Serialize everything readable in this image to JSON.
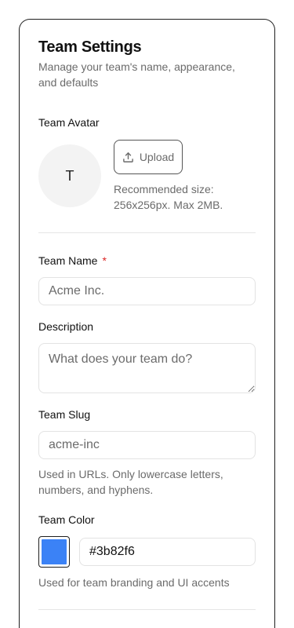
{
  "header": {
    "title": "Team Settings",
    "subtitle": "Manage your team's name, appearance, and defaults"
  },
  "avatar": {
    "label": "Team Avatar",
    "initial": "T",
    "upload_label": "Upload",
    "upload_icon": "upload-icon",
    "hint": "Recommended size: 256x256px. Max 2MB."
  },
  "team_name": {
    "label": "Team Name",
    "required_marker": "*",
    "placeholder": "Acme Inc.",
    "value": ""
  },
  "description": {
    "label": "Description",
    "placeholder": "What does your team do?",
    "value": ""
  },
  "team_slug": {
    "label": "Team Slug",
    "placeholder": "acme-inc",
    "value": "",
    "hint": "Used in URLs. Only lowercase letters, numbers, and hyphens."
  },
  "team_color": {
    "label": "Team Color",
    "value": "#3b82f6",
    "swatch_color": "#3b82f6",
    "hint": "Used for team branding and UI accents"
  },
  "colors": {
    "required": "#dc2626",
    "muted_text": "#6b6b6b",
    "border": "#e3e3e3"
  }
}
